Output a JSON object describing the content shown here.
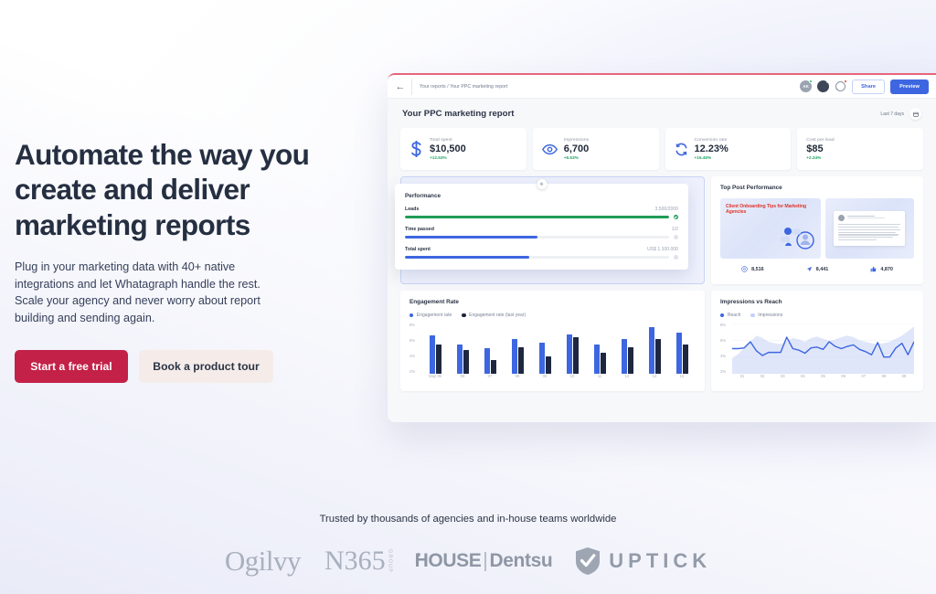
{
  "hero": {
    "headline": "Automate the way you create and deliver marketing reports",
    "subtext": "Plug in your marketing data with 40+ native integrations and let Whatagraph handle the rest. Scale your agency and never worry about report building and sending again.",
    "primary_cta": "Start a free trial",
    "secondary_cta": "Book a product tour"
  },
  "dashboard": {
    "breadcrumb": "Your reports / Your PPC marketing report",
    "back_icon": "back-arrow-icon",
    "avatars": [
      {
        "initials": "AK",
        "status": "online"
      },
      {
        "initials": "",
        "status": "online"
      }
    ],
    "notification_icon": "bell-icon",
    "share_label": "Share",
    "preview_label": "Preview",
    "report_title": "Your PPC marketing report",
    "date_range": "Last 7 days",
    "calendar_icon": "calendar-icon",
    "accent_color": "#3d66e0",
    "top_border_color": "#e8657b",
    "kpis": [
      {
        "label": "Total spent",
        "value": "$10,500",
        "delta": "+12.53%",
        "icon": "dollar-icon"
      },
      {
        "label": "Impressions",
        "value": "6,700",
        "delta": "+6.53%",
        "icon": "eye-icon"
      },
      {
        "label": "Conversion rate",
        "value": "12.23%",
        "delta": "+15.45%",
        "icon": "refresh-icon"
      },
      {
        "label": "Cost per lead",
        "value": "$85",
        "delta": "+2.34%",
        "icon": "none"
      }
    ],
    "performance": {
      "title": "Performance",
      "drag_icon": "drag-handle-icon",
      "items": [
        {
          "name": "Leads",
          "value": "3,500/2000",
          "percent": 100,
          "color": "green",
          "state": "done"
        },
        {
          "name": "Time passed",
          "value": "1/2",
          "percent": 50,
          "color": "blue",
          "state": "idle"
        },
        {
          "name": "Total spent",
          "value": "US$ 1.100.000",
          "percent": 47,
          "color": "blue",
          "state": "idle"
        }
      ]
    },
    "top_post": {
      "title": "Top Post Performance",
      "thumb_headline": "Client Onboarding Tips for Marketing Agencies",
      "stats": [
        {
          "icon": "eye-icon",
          "value": "8,516"
        },
        {
          "icon": "share-icon",
          "value": "8,441"
        },
        {
          "icon": "thumbup-icon",
          "value": "4,870"
        }
      ]
    }
  },
  "chart_data": [
    {
      "type": "bar",
      "title": "Engagement Rate",
      "categories": [
        "May 05",
        "06",
        "07",
        "08",
        "09",
        "10",
        "11",
        "12",
        "13",
        "14"
      ],
      "series": [
        {
          "name": "Engagement rate",
          "color": "#3d66e0",
          "values": [
            7.9,
            6.3,
            5.8,
            7.2,
            6.6,
            8.0,
            6.3,
            7.2,
            9.2,
            8.3
          ]
        },
        {
          "name": "Engagement rate (last year)",
          "color": "#1e2740",
          "values": [
            6.4,
            5.5,
            3.9,
            5.9,
            4.4,
            7.5,
            5.1,
            5.9,
            7.3,
            6.4
          ]
        }
      ],
      "ylabel": "",
      "xlabel": "",
      "yticks": [
        "8%",
        "6%",
        "4%",
        "2%"
      ],
      "ylim": [
        1.6,
        9.8
      ],
      "grid": false,
      "legend": "top"
    },
    {
      "type": "area",
      "title": "Impressions vs Reach",
      "x": [
        "01",
        "02",
        "03",
        "04",
        "05",
        "06",
        "07",
        "08",
        "09"
      ],
      "series": [
        {
          "name": "Reach",
          "color": "#3d66e0",
          "kind": "line",
          "values": [
            4.9,
            4.9,
            5.0,
            5.8,
            4.6,
            4.0,
            4.4,
            4.4,
            4.4,
            6.4,
            4.9,
            4.7,
            4.3,
            5.0,
            5.1,
            4.8,
            5.8,
            5.2,
            4.9,
            5.2,
            5.4,
            4.8,
            4.5,
            4.1,
            5.7,
            3.8,
            3.8,
            5.0,
            5.6,
            4.1,
            5.8
          ]
        },
        {
          "name": "Impressions",
          "color": "#c6d2f5",
          "kind": "area",
          "values": [
            3.6,
            4.2,
            5.0,
            5.8,
            6.6,
            6.3,
            5.8,
            5.6,
            5.5,
            5.9,
            6.3,
            6.1,
            5.8,
            6.3,
            6.5,
            6.2,
            5.9,
            6.1,
            6.4,
            6.6,
            6.4,
            6.0,
            5.8,
            5.6,
            5.5,
            5.6,
            5.8,
            6.2,
            6.6,
            7.2,
            7.8
          ]
        }
      ],
      "yticks": [
        "8%",
        "6%",
        "4%",
        "2%"
      ],
      "ylim": [
        1.6,
        8.2
      ],
      "grid": true,
      "legend": "top"
    }
  ],
  "social_proof": {
    "tagline": "Trusted by thousands of agencies and in-house teams worldwide",
    "logos": [
      {
        "name": "Ogilvy",
        "text": "Ogilvy"
      },
      {
        "name": "N365 Group",
        "text": "N365",
        "sub": "GROUP"
      },
      {
        "name": "iHOUSE Dentsu",
        "text": "HOUSE",
        "text2": "Dentsu"
      },
      {
        "name": "Uptick",
        "text": "UPTICK"
      }
    ]
  }
}
